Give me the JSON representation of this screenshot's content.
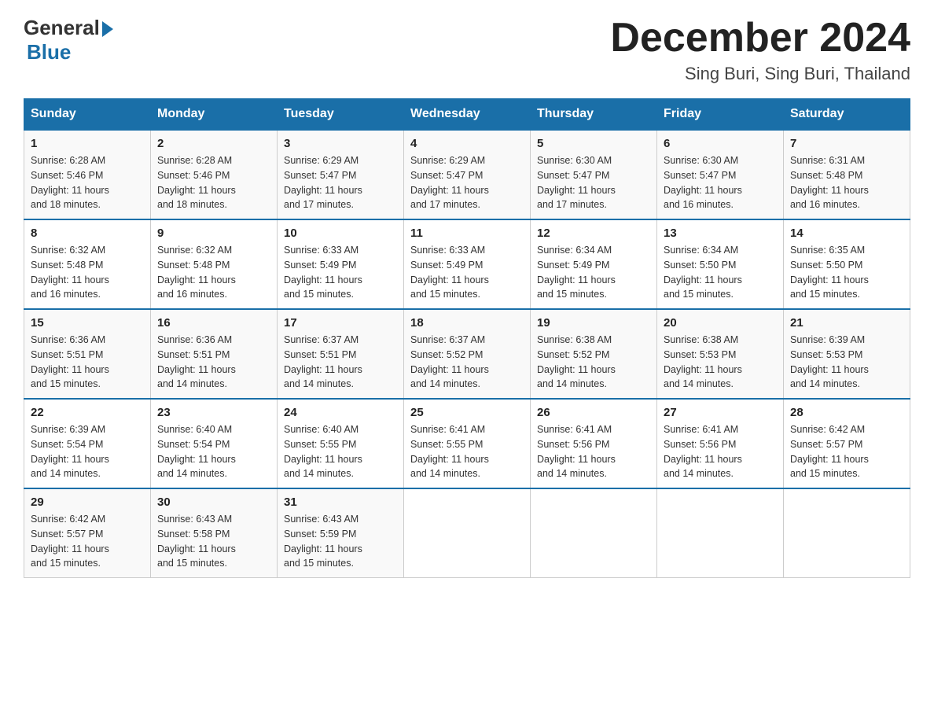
{
  "header": {
    "logo_general": "General",
    "logo_blue": "Blue",
    "month_title": "December 2024",
    "location": "Sing Buri, Sing Buri, Thailand"
  },
  "columns": [
    "Sunday",
    "Monday",
    "Tuesday",
    "Wednesday",
    "Thursday",
    "Friday",
    "Saturday"
  ],
  "weeks": [
    [
      {
        "day": "1",
        "sunrise": "6:28 AM",
        "sunset": "5:46 PM",
        "daylight": "11 hours and 18 minutes."
      },
      {
        "day": "2",
        "sunrise": "6:28 AM",
        "sunset": "5:46 PM",
        "daylight": "11 hours and 18 minutes."
      },
      {
        "day": "3",
        "sunrise": "6:29 AM",
        "sunset": "5:47 PM",
        "daylight": "11 hours and 17 minutes."
      },
      {
        "day": "4",
        "sunrise": "6:29 AM",
        "sunset": "5:47 PM",
        "daylight": "11 hours and 17 minutes."
      },
      {
        "day": "5",
        "sunrise": "6:30 AM",
        "sunset": "5:47 PM",
        "daylight": "11 hours and 17 minutes."
      },
      {
        "day": "6",
        "sunrise": "6:30 AM",
        "sunset": "5:47 PM",
        "daylight": "11 hours and 16 minutes."
      },
      {
        "day": "7",
        "sunrise": "6:31 AM",
        "sunset": "5:48 PM",
        "daylight": "11 hours and 16 minutes."
      }
    ],
    [
      {
        "day": "8",
        "sunrise": "6:32 AM",
        "sunset": "5:48 PM",
        "daylight": "11 hours and 16 minutes."
      },
      {
        "day": "9",
        "sunrise": "6:32 AM",
        "sunset": "5:48 PM",
        "daylight": "11 hours and 16 minutes."
      },
      {
        "day": "10",
        "sunrise": "6:33 AM",
        "sunset": "5:49 PM",
        "daylight": "11 hours and 15 minutes."
      },
      {
        "day": "11",
        "sunrise": "6:33 AM",
        "sunset": "5:49 PM",
        "daylight": "11 hours and 15 minutes."
      },
      {
        "day": "12",
        "sunrise": "6:34 AM",
        "sunset": "5:49 PM",
        "daylight": "11 hours and 15 minutes."
      },
      {
        "day": "13",
        "sunrise": "6:34 AM",
        "sunset": "5:50 PM",
        "daylight": "11 hours and 15 minutes."
      },
      {
        "day": "14",
        "sunrise": "6:35 AM",
        "sunset": "5:50 PM",
        "daylight": "11 hours and 15 minutes."
      }
    ],
    [
      {
        "day": "15",
        "sunrise": "6:36 AM",
        "sunset": "5:51 PM",
        "daylight": "11 hours and 15 minutes."
      },
      {
        "day": "16",
        "sunrise": "6:36 AM",
        "sunset": "5:51 PM",
        "daylight": "11 hours and 14 minutes."
      },
      {
        "day": "17",
        "sunrise": "6:37 AM",
        "sunset": "5:51 PM",
        "daylight": "11 hours and 14 minutes."
      },
      {
        "day": "18",
        "sunrise": "6:37 AM",
        "sunset": "5:52 PM",
        "daylight": "11 hours and 14 minutes."
      },
      {
        "day": "19",
        "sunrise": "6:38 AM",
        "sunset": "5:52 PM",
        "daylight": "11 hours and 14 minutes."
      },
      {
        "day": "20",
        "sunrise": "6:38 AM",
        "sunset": "5:53 PM",
        "daylight": "11 hours and 14 minutes."
      },
      {
        "day": "21",
        "sunrise": "6:39 AM",
        "sunset": "5:53 PM",
        "daylight": "11 hours and 14 minutes."
      }
    ],
    [
      {
        "day": "22",
        "sunrise": "6:39 AM",
        "sunset": "5:54 PM",
        "daylight": "11 hours and 14 minutes."
      },
      {
        "day": "23",
        "sunrise": "6:40 AM",
        "sunset": "5:54 PM",
        "daylight": "11 hours and 14 minutes."
      },
      {
        "day": "24",
        "sunrise": "6:40 AM",
        "sunset": "5:55 PM",
        "daylight": "11 hours and 14 minutes."
      },
      {
        "day": "25",
        "sunrise": "6:41 AM",
        "sunset": "5:55 PM",
        "daylight": "11 hours and 14 minutes."
      },
      {
        "day": "26",
        "sunrise": "6:41 AM",
        "sunset": "5:56 PM",
        "daylight": "11 hours and 14 minutes."
      },
      {
        "day": "27",
        "sunrise": "6:41 AM",
        "sunset": "5:56 PM",
        "daylight": "11 hours and 14 minutes."
      },
      {
        "day": "28",
        "sunrise": "6:42 AM",
        "sunset": "5:57 PM",
        "daylight": "11 hours and 15 minutes."
      }
    ],
    [
      {
        "day": "29",
        "sunrise": "6:42 AM",
        "sunset": "5:57 PM",
        "daylight": "11 hours and 15 minutes."
      },
      {
        "day": "30",
        "sunrise": "6:43 AM",
        "sunset": "5:58 PM",
        "daylight": "11 hours and 15 minutes."
      },
      {
        "day": "31",
        "sunrise": "6:43 AM",
        "sunset": "5:59 PM",
        "daylight": "11 hours and 15 minutes."
      },
      null,
      null,
      null,
      null
    ]
  ],
  "labels": {
    "sunrise": "Sunrise:",
    "sunset": "Sunset:",
    "daylight": "Daylight:"
  }
}
